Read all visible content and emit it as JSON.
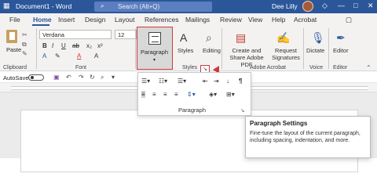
{
  "title_bar": {
    "document_title": "Document1 - Word",
    "search_placeholder": "Search (Alt+Q)",
    "user_name": "Dee Lilly"
  },
  "tabs": [
    "File",
    "Home",
    "Insert",
    "Design",
    "Layout",
    "References",
    "Mailings",
    "Review",
    "View",
    "Help",
    "Acrobat"
  ],
  "active_tab": "Home",
  "ribbon": {
    "clipboard": {
      "paste_label": "Paste",
      "group_label": "Clipboard"
    },
    "font": {
      "font_name": "Verdana",
      "font_size": "12",
      "group_label": "Font"
    },
    "paragraph": {
      "button_label": "Paragraph"
    },
    "styles": {
      "button_label": "Styles",
      "group_label": "Styles"
    },
    "editing": {
      "button_label": "Editing"
    },
    "acrobat": {
      "create_share_label": "Create and Share Adobe PDF",
      "request_signatures_label": "Request Signatures",
      "group_label": "Adobe Acrobat"
    },
    "voice": {
      "dictate_label": "Dictate",
      "group_label": "Voice"
    },
    "editor": {
      "editor_label": "Editor",
      "group_label": "Editor"
    }
  },
  "quick_access": {
    "autosave_label": "AutoSave",
    "autosave_state": "Off"
  },
  "paragraph_panel": {
    "group_label": "Paragraph"
  },
  "tooltip": {
    "title": "Paragraph Settings",
    "body": "Fine-tune the layout of the current paragraph, including spacing, indentation, and more."
  },
  "colors": {
    "brand_blue": "#2b579a",
    "highlight_red": "#d0393b"
  }
}
